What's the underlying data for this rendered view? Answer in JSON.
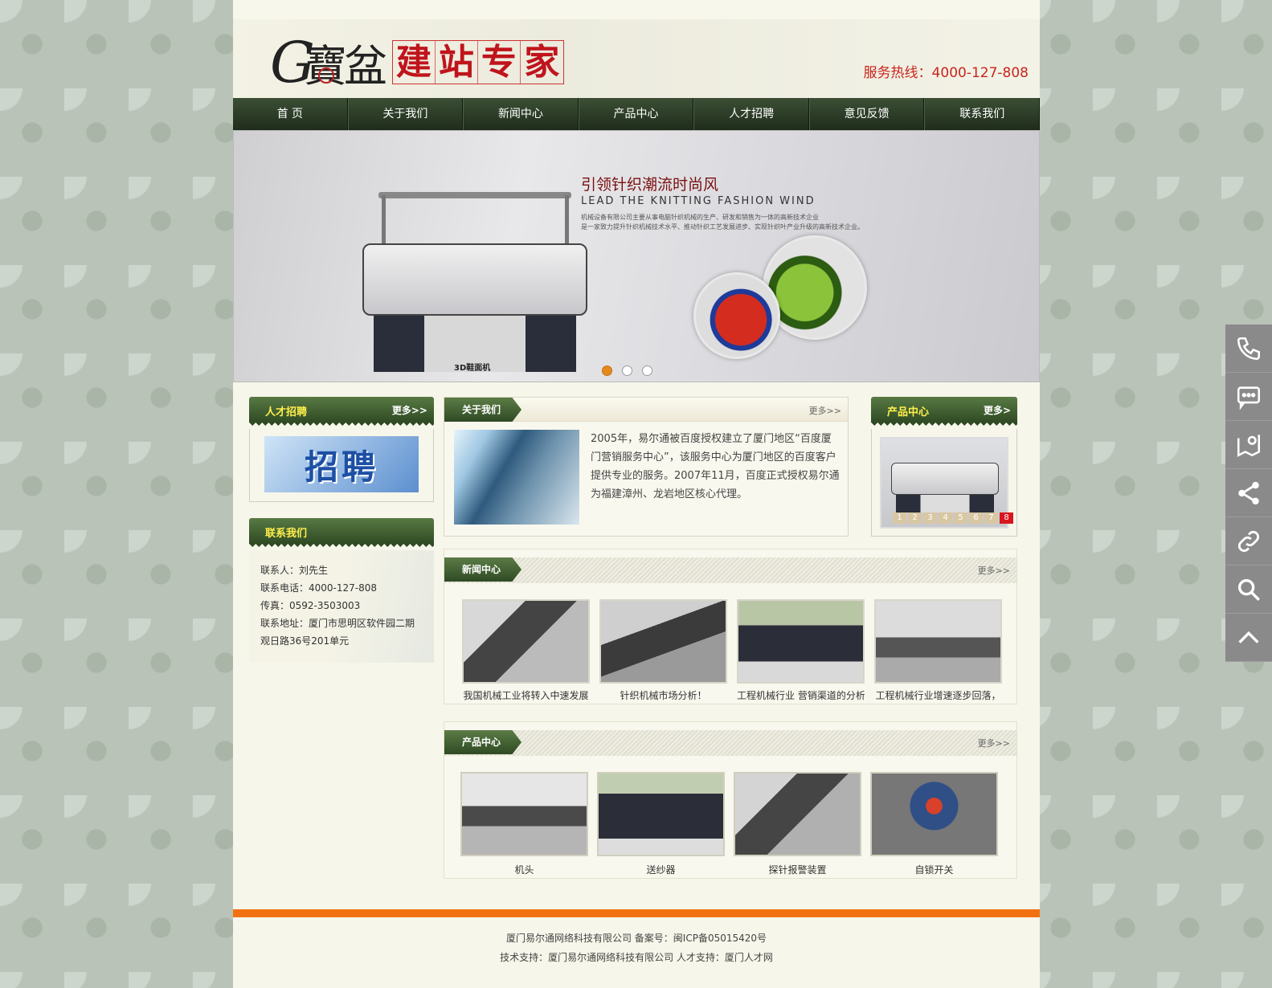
{
  "header": {
    "hotline": "服务热线：4000-127-808",
    "slogan": [
      "建",
      "站",
      "专",
      "家"
    ],
    "logo_text": "寶盆"
  },
  "nav": [
    "首 页",
    "关于我们",
    "新闻中心",
    "产品中心",
    "人才招聘",
    "意见反馈",
    "联系我们"
  ],
  "banner": {
    "title": "引领针织潮流时尚风",
    "subtitle": "LEAD THE KNITTING FASHION WIND",
    "desc1": "机械设备有限公司主要从事电脑针织机械的生产、研发和销售为一体的高新技术企业",
    "desc2": "是一家致力提升针织机械技术水平、推动针织工艺发展进步、实现针织叶产业升级的高新技术企业。",
    "caption": "3D鞋面机",
    "slides": 3,
    "active_slide": 1
  },
  "recruit": {
    "title": "人才招聘",
    "more": "更多>>",
    "image_text": "招聘"
  },
  "contact": {
    "title": "联系我们",
    "lines": [
      "联系人：刘先生",
      "联系电话：4000-127-808",
      "传真：0592-3503003",
      "联系地址：厦门市思明区软件园二期",
      "观日路36号201单元"
    ]
  },
  "about": {
    "title": "关于我们",
    "more": "更多>>",
    "text": "2005年，易尔通被百度授权建立了厦门地区“百度厦门营销服务中心”，该服务中心为厦门地区的百度客户提供专业的服务。2007年11月，百度正式授权易尔通为福建漳州、龙岩地区核心代理。"
  },
  "product_side": {
    "title": "产品中心",
    "more": "更多>",
    "pages": [
      "1",
      "2",
      "3",
      "4",
      "5",
      "6",
      "7",
      "8"
    ],
    "active_page": "8"
  },
  "news": {
    "title": "新闻中心",
    "more": "更多>>",
    "items": [
      "我国机械工业将转入中速发展",
      "针织机械市场分析！",
      "工程机械行业 营销渠道的分析",
      "工程机械行业增速逐步回落，"
    ]
  },
  "products": {
    "title": "产品中心",
    "more": "更多>>",
    "items": [
      "机头",
      "送纱器",
      "探针报警装置",
      "自锁开关"
    ]
  },
  "footer": {
    "line1": "厦门易尔通网络科技有限公司 备案号：闽ICP备05015420号",
    "line2": "技术支持：厦门易尔通网络科技有限公司 人才支持：厦门人才网"
  },
  "sidebar": [
    "phone-icon",
    "message-icon",
    "map-icon",
    "share-icon",
    "link-icon",
    "search-icon",
    "back-to-top-icon"
  ],
  "colors": {
    "nav_dark": "#1f2c1b",
    "accent_red": "#c8241c",
    "footer_orange": "#f27212",
    "tag_green": "#3f5f30"
  }
}
